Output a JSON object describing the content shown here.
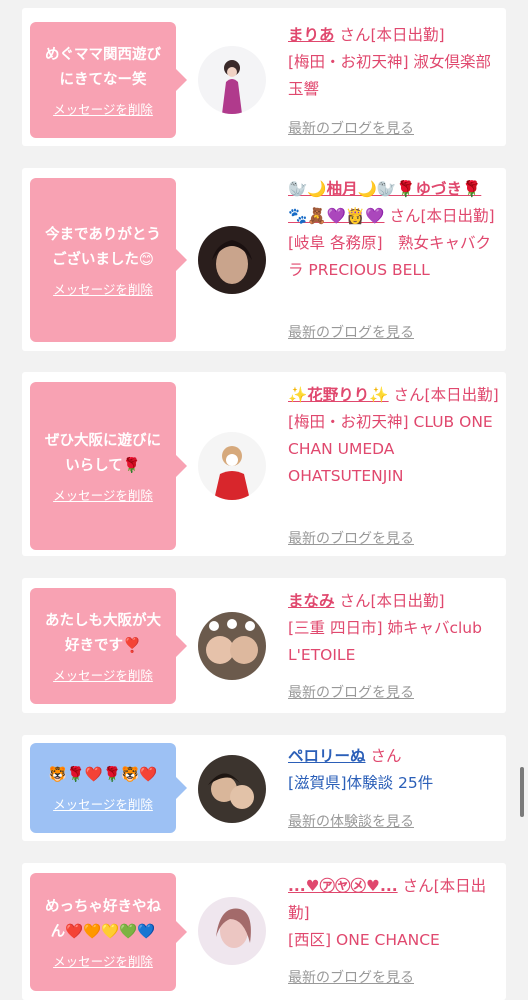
{
  "colors": {
    "pink_bubble": "#f8a2b3",
    "blue_bubble": "#9dc1f4",
    "accent": "#e0486e",
    "link_blue": "#2b5fb8",
    "muted": "#999999"
  },
  "items": [
    {
      "message": "めぐママ関西遊びにきてなー笑",
      "delete_label": "メッセージを削除",
      "name": "まりあ",
      "san": "さん[本日出勤]",
      "shop": "[梅田・お初天神] 淑女倶楽部 玉響",
      "link": "最新のブログを見る"
    },
    {
      "message": "今までありがとうございました😊",
      "delete_label": "メッセージを削除",
      "name": "🦭🌙柚月🌙🦭🌹ゆづき🌹🐾🧸💜👸💜",
      "san": "さん[本日出勤]",
      "shop": "[岐阜 各務原]　熟女キャバクラ PRECIOUS BELL",
      "link": "最新のブログを見る"
    },
    {
      "message": "ぜひ大阪に遊びにいらして🌹",
      "delete_label": "メッセージを削除",
      "name": "✨花野りり✨",
      "san": "さん[本日出勤]",
      "shop": "[梅田・お初天神] CLUB ONE CHAN UMEDA OHATSUTENJIN",
      "link": "最新のブログを見る"
    },
    {
      "message": "あたしも大阪が大好きです❣️",
      "delete_label": "メッセージを削除",
      "name": "まなみ",
      "san": "さん[本日出勤]",
      "shop": "[三重 四日市] 姉キャバclub L'ETOILE",
      "link": "最新のブログを見る"
    },
    {
      "message": "🐯🌹❤️🌹🐯❤️",
      "delete_label": "メッセージを削除",
      "name": "ペロリーぬ",
      "san": "さん",
      "shop": "[滋賀県]体験談 25件",
      "link": "最新の体験談を見る"
    },
    {
      "message": "めっちゃ好きやねん❤️🧡💛💚💙",
      "delete_label": "メッセージを削除",
      "name": "...♥㋐㋳㋱♥...",
      "san": "さん[本日出勤]",
      "shop": "[西区] ONE CHANCE",
      "link": "最新のブログを見る"
    }
  ]
}
